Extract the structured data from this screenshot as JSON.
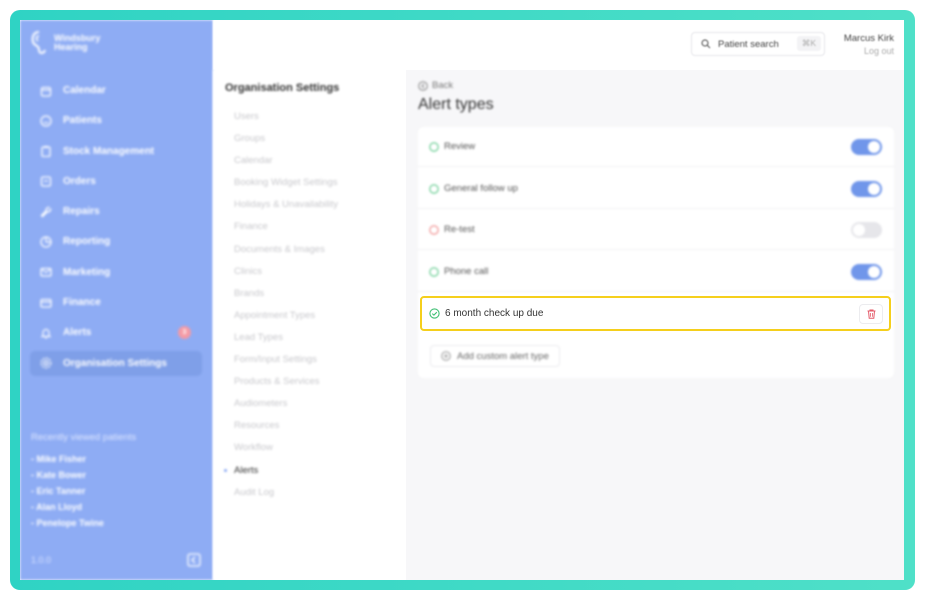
{
  "brand": {
    "name": "Windsbury Hearing"
  },
  "sidebar": {
    "items": [
      {
        "label": "Calendar",
        "icon": "calendar-icon"
      },
      {
        "label": "Patients",
        "icon": "patients-icon"
      },
      {
        "label": "Stock Management",
        "icon": "clipboard-icon"
      },
      {
        "label": "Orders",
        "icon": "orders-icon"
      },
      {
        "label": "Repairs",
        "icon": "wrench-icon"
      },
      {
        "label": "Reporting",
        "icon": "chart-icon"
      },
      {
        "label": "Marketing",
        "icon": "mail-icon"
      },
      {
        "label": "Finance",
        "icon": "card-icon"
      },
      {
        "label": "Alerts",
        "icon": "bell-icon",
        "badge": "3"
      },
      {
        "label": "Organisation Settings",
        "icon": "gear-icon",
        "active": true
      }
    ],
    "recent_title": "Recently viewed patients",
    "recent": [
      "- Mike Fisher",
      "- Kate Bower",
      "- Eric Tanner",
      "- Alan Lloyd",
      "- Penelope Twine"
    ],
    "version": "1.0.0"
  },
  "topbar": {
    "search_label": "Patient search",
    "search_shortcut": "⌘K",
    "user_name": "Marcus Kirk",
    "logout": "Log out"
  },
  "settings_nav": {
    "title": "Organisation Settings",
    "items": [
      "Users",
      "Groups",
      "Calendar",
      "Booking Widget Settings",
      "Holidays & Unavailability",
      "Finance",
      "Documents & Images",
      "Clinics",
      "Brands",
      "Appointment Types",
      "Lead Types",
      "Form/Input Settings",
      "Products & Services",
      "Audiometers",
      "Resources",
      "Workflow",
      "Alerts",
      "Audit Log"
    ],
    "active_index": 16
  },
  "main": {
    "back_label": "Back",
    "title": "Alert types",
    "alert_types": [
      {
        "label": "Review",
        "enabled": true,
        "status_color": "#5cc98a"
      },
      {
        "label": "General follow up",
        "enabled": true,
        "status_color": "#5cc98a"
      },
      {
        "label": "Re-test",
        "enabled": false,
        "status_color": "#f08a8a"
      },
      {
        "label": "Phone call",
        "enabled": true,
        "status_color": "#5cc98a"
      }
    ],
    "custom_row": {
      "label": "6 month check up due",
      "status_color": "#3fbf74"
    },
    "add_label": "Add custom alert type"
  },
  "colors": {
    "sidebar": "#8eacf4",
    "highlight": "#f5cf1c",
    "toggle_on": "#7096ea"
  }
}
